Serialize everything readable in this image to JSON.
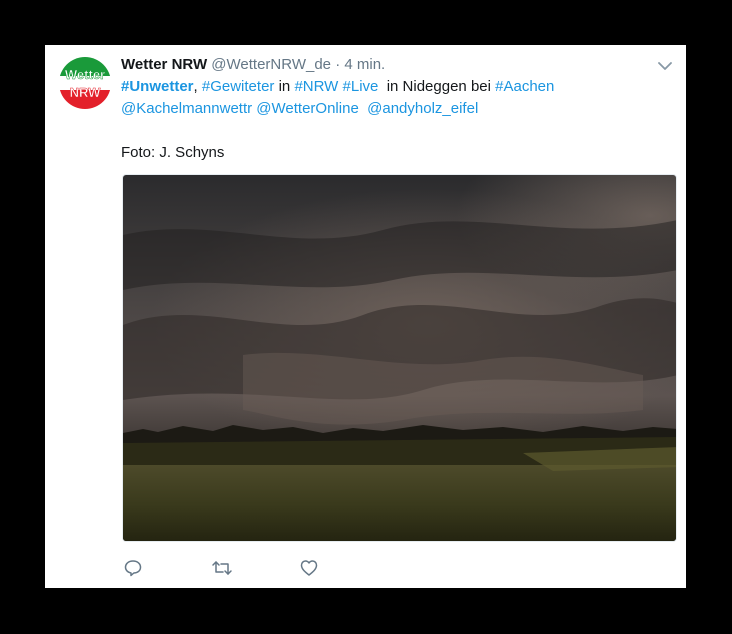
{
  "tweet": {
    "author_name": "Wetter NRW",
    "handle": "@WetterNRW_de",
    "separator": "·",
    "time": "4 min.",
    "avatar_text_top": "Wetter",
    "avatar_text_bottom": "NRW",
    "line1": {
      "t1": "#Unwetter",
      "t2": ", ",
      "t3": "#Gewiteter",
      "t4": " in ",
      "t5": "#NRW",
      "t6": " ",
      "t7": "#Live",
      "t8": "  in Nideggen bei ",
      "t9": "#Aachen"
    },
    "line2": {
      "m1": "@Kachelmannwettr",
      "s1": " ",
      "m2": "@WetterOnline",
      "s2": "  ",
      "m3": "@andyholz_eifel"
    },
    "credit": "Foto: J. Schyns",
    "photo_alt": "Storm clouds over fields near Nideggen"
  },
  "icons": {
    "more": "chevron-down-icon",
    "reply": "reply-icon",
    "retweet": "retweet-icon",
    "like": "heart-icon"
  },
  "colors": {
    "link": "#1b95e0",
    "text": "#14171a",
    "muted": "#657786",
    "avatar_green": "#1a9a3a",
    "avatar_red": "#e3202a"
  }
}
